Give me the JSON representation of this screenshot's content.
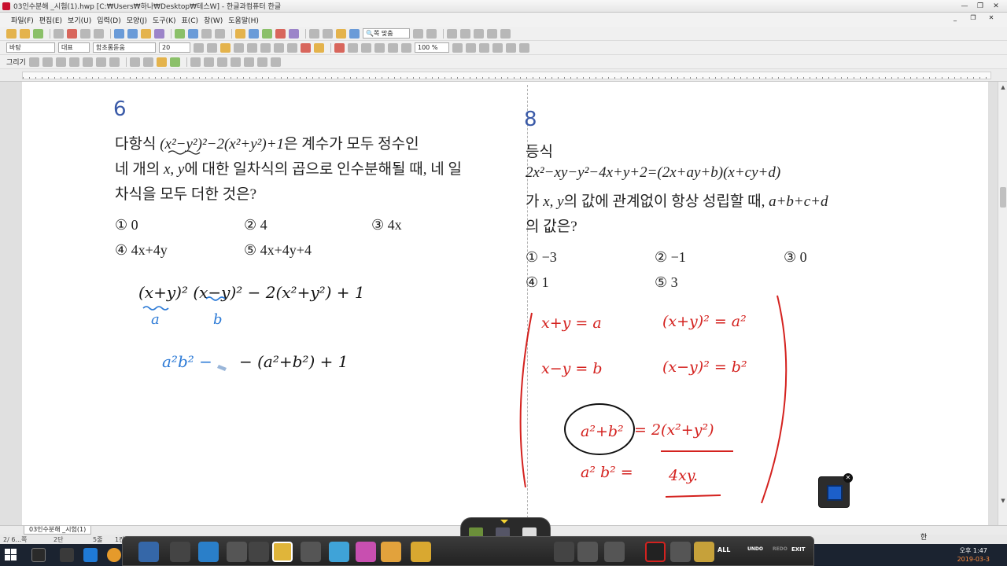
{
  "window": {
    "title": "03인수분해 _시험(1).hwp [C:₩Users₩하나₩Desktop₩테스W] - 한글과컴퓨터 한글"
  },
  "menu": [
    "파일(F)",
    "편집(E)",
    "보기(U)",
    "입력(D)",
    "모양(J)",
    "도구(K)",
    "표(C)",
    "창(W)",
    "도움말(H)"
  ],
  "toolbar": {
    "zoom_fit": "쪽 맞춤",
    "style": "바탕",
    "lang": "대표",
    "font": "함초롬돋움",
    "size": "20",
    "zoom_pct": "100 %",
    "draw_label": "그리기"
  },
  "problem6": {
    "number": "6",
    "line1_pre": "다항식 ",
    "line1_math": "(x²−y²)²−2(x²+y²)+1",
    "line1_post": "은  계수가  모두  정수인",
    "line2_pre": "네 개의 ",
    "line2_math": "x, y",
    "line2_post": "에 대한 일차식의 곱으로 인수분해될 때, 네 일",
    "line3": "차식을 모두 더한 것은?",
    "choices": [
      "① 0",
      "② 4",
      "③ 4x",
      "④ 4x+4y",
      "⑤ 4x+4y+4"
    ]
  },
  "problem8": {
    "number": "8",
    "line1": "등식",
    "line2_math": "2x²−xy−y²−4x+y+2=(2x+ay+b)(x+cy+d)",
    "line3_pre": "가 ",
    "line3_math": "x, y",
    "line3_mid": "의 값에 관계없이 항상 성립할 때, ",
    "line3_post_math": "a+b+c+d",
    "line4": "의 값은?",
    "choices": [
      "① −3",
      "② −1",
      "③ 0",
      "④ 1",
      "⑤ 3"
    ]
  },
  "handwriting": {
    "left_line1": "(x+y)² (x−y)² − 2(x²+y²) + 1",
    "left_a": "a",
    "left_b": "b",
    "left_line2_blue": "a²b² −",
    "left_line2_black": "−  (a²+b²)   + 1",
    "right_1a": "x+y = a",
    "right_1b": "(x+y)² = a²",
    "right_2a": "x−y = b",
    "right_2b": "(x−y)² = b²",
    "right_3a": "a²+b²",
    "right_3b": "= 2(x²+y²)",
    "right_4a": "a² b² =",
    "right_4b": "4xy."
  },
  "doc_tab": "03인수분해 _시험(1)",
  "status": {
    "page": "2/ 6...쪽",
    "section": "2단",
    "line": "5줄",
    "col": "1칸"
  },
  "taskbar": {
    "lang": "한",
    "time": "오후 1:47",
    "date": "2019-03-3"
  },
  "pen_dock": {
    "all_label": "ALL",
    "undo_label": "UNDO",
    "redo_label": "REDO",
    "exit_label": "EXIT"
  },
  "colors": {
    "heading_blue": "#3a5aa8",
    "ink_black": "#161616",
    "ink_blue": "#2c7ad6",
    "ink_red": "#d4221f"
  }
}
